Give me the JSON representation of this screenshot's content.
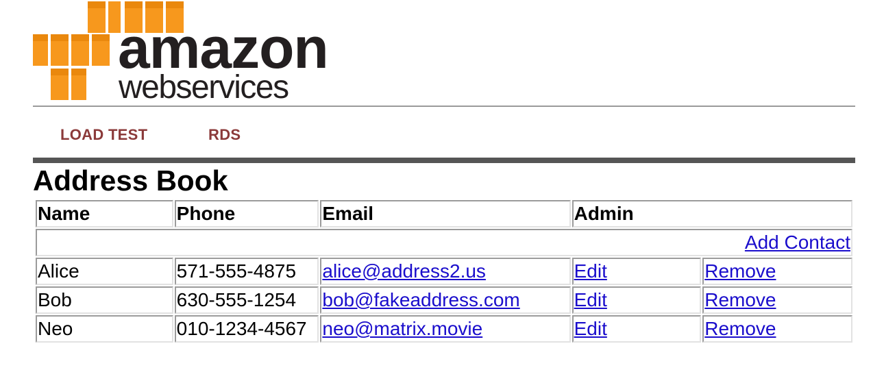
{
  "logo": {
    "line1": "amazon",
    "line2": "webservices",
    "cube_color": "#f7981d",
    "text_color": "#231f20"
  },
  "nav": {
    "items": [
      {
        "label": "LOAD TEST"
      },
      {
        "label": "RDS"
      }
    ],
    "color": "#8b3a3a"
  },
  "page_title": "Address Book",
  "table": {
    "headers": {
      "name": "Name",
      "phone": "Phone",
      "email": "Email",
      "admin": "Admin"
    },
    "add_contact": "Add Contact",
    "rows": [
      {
        "name": "Alice",
        "phone": "571-555-4875",
        "email": "alice@address2.us",
        "edit": "Edit",
        "remove": "Remove"
      },
      {
        "name": "Bob",
        "phone": "630-555-1254",
        "email": "bob@fakeaddress.com",
        "edit": "Edit",
        "remove": "Remove"
      },
      {
        "name": "Neo",
        "phone": "010-1234-4567",
        "email": "neo@matrix.movie",
        "edit": "Edit",
        "remove": "Remove"
      }
    ],
    "link_color": "#1a0dcc"
  }
}
